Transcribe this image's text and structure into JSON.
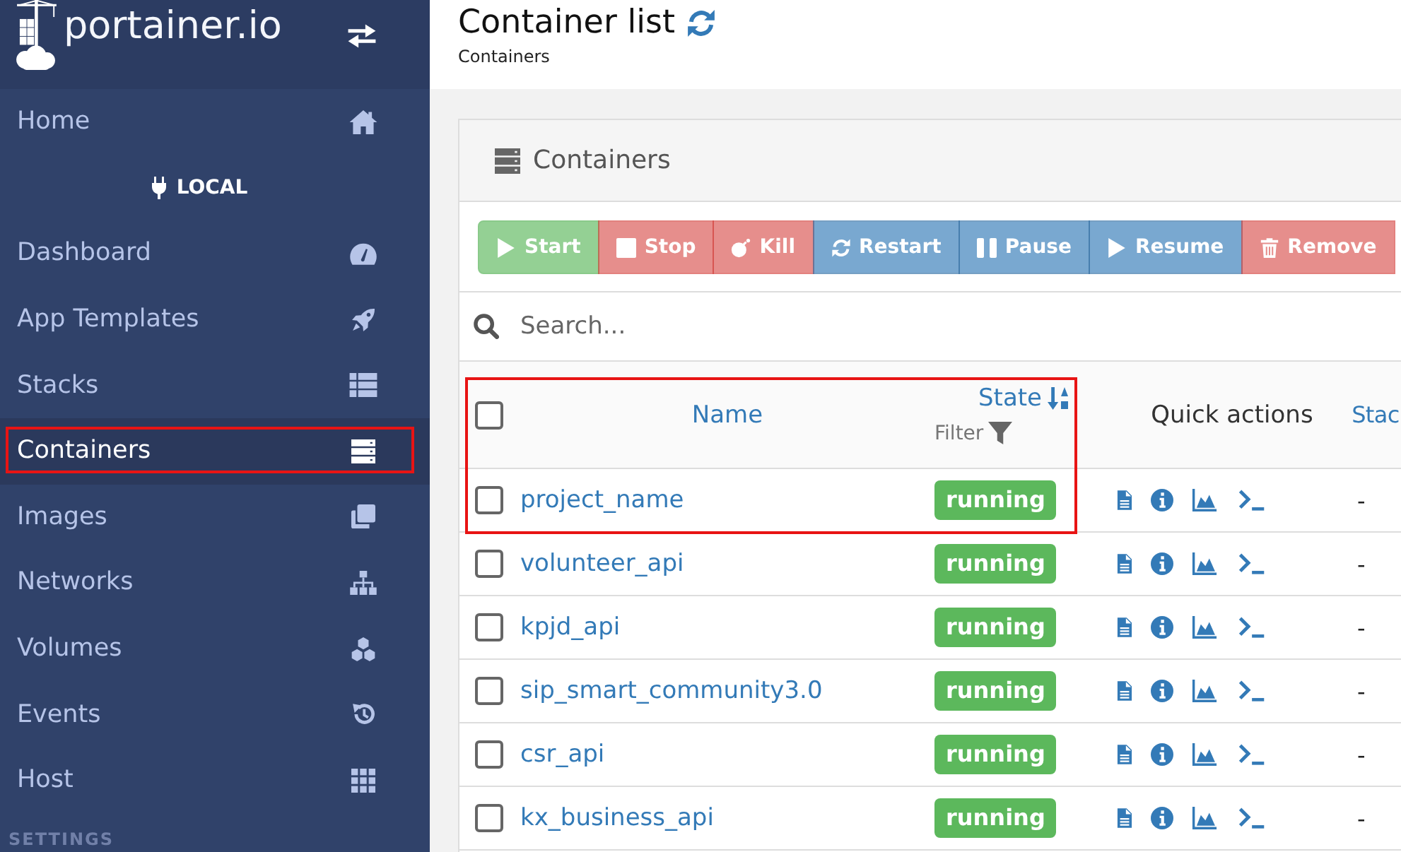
{
  "sidebar": {
    "brand": "portainer.io",
    "nav": [
      {
        "label": "Home",
        "selected": false,
        "highlighted": false
      }
    ],
    "endpoint": "LOCAL",
    "items": [
      {
        "label": "Dashboard",
        "selected": false,
        "highlighted": false
      },
      {
        "label": "App Templates",
        "selected": false,
        "highlighted": false
      },
      {
        "label": "Stacks",
        "selected": false,
        "highlighted": false
      },
      {
        "label": "Containers",
        "selected": true,
        "highlighted": true
      },
      {
        "label": "Images",
        "selected": false,
        "highlighted": false
      },
      {
        "label": "Networks",
        "selected": false,
        "highlighted": false
      },
      {
        "label": "Volumes",
        "selected": false,
        "highlighted": false
      },
      {
        "label": "Events",
        "selected": false,
        "highlighted": false
      },
      {
        "label": "Host",
        "selected": false,
        "highlighted": false
      }
    ],
    "section_heading": "SETTINGS"
  },
  "header": {
    "title": "Container list",
    "breadcrumb": "Containers"
  },
  "panel": {
    "title": "Containers",
    "actions": [
      {
        "label": "Start",
        "kind": "success",
        "disabled": true
      },
      {
        "label": "Stop",
        "kind": "danger",
        "disabled": true
      },
      {
        "label": "Kill",
        "kind": "danger",
        "disabled": true
      },
      {
        "label": "Restart",
        "kind": "primary",
        "disabled": true
      },
      {
        "label": "Pause",
        "kind": "primary",
        "disabled": true
      },
      {
        "label": "Resume",
        "kind": "primary",
        "disabled": true
      },
      {
        "label": "Remove",
        "kind": "danger",
        "disabled": true
      }
    ],
    "search": {
      "placeholder": "Search..."
    },
    "table": {
      "highlighted": true,
      "select_all": {
        "checked": false
      },
      "columns": [
        {
          "label": "Name",
          "sortable": true,
          "sorted": false
        },
        {
          "label": "State",
          "sortable": true,
          "sorted": true,
          "filter": "Filter"
        },
        {
          "label": "Quick actions",
          "sortable": false,
          "sorted": false
        },
        {
          "label": "Stac",
          "sortable": true,
          "sorted": false
        }
      ],
      "rows": [
        {
          "checked": false,
          "name": "project_name",
          "state": "running",
          "column_4": "-"
        },
        {
          "checked": false,
          "name": "volunteer_api",
          "state": "running",
          "column_4": "-"
        },
        {
          "checked": false,
          "name": "kpjd_api",
          "state": "running",
          "column_4": "-"
        },
        {
          "checked": false,
          "name": "sip_smart_community3.0",
          "state": "running",
          "column_4": "-"
        },
        {
          "checked": false,
          "name": "csr_api",
          "state": "running",
          "column_4": "-"
        },
        {
          "checked": false,
          "name": "kx_business_api",
          "state": "running",
          "column_4": "-"
        }
      ]
    }
  }
}
